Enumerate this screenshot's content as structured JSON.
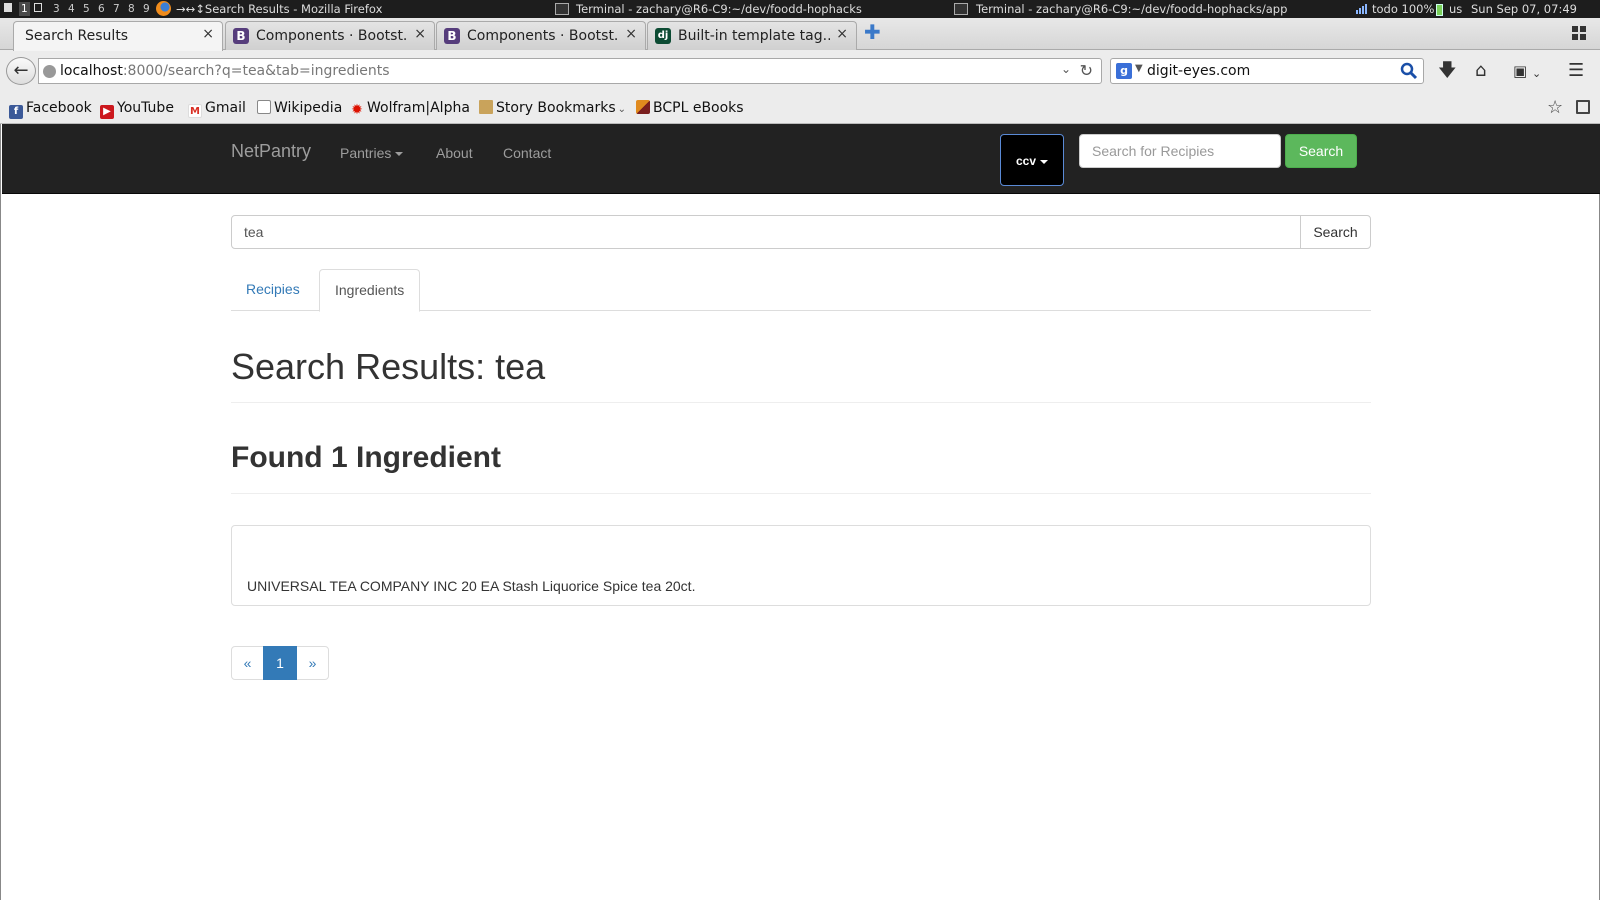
{
  "wm": {
    "workspaces": [
      "1",
      "2",
      "3",
      "4",
      "5",
      "6",
      "7",
      "8",
      "9"
    ],
    "window_title": "→↔↕Search Results - Mozilla Firefox",
    "terminal1": "Terminal - zachary@R6-C9:~/dev/foodd-hophacks",
    "terminal2": "Terminal - zachary@R6-C9:~/dev/foodd-hophacks/app",
    "status": "todo 100%",
    "keyboard": "us",
    "clock": "Sun Sep 07, 07:49"
  },
  "browser": {
    "tabs": [
      {
        "label": "Search Results",
        "active": true
      },
      {
        "label": "Components · Bootst...",
        "favicon": "B"
      },
      {
        "label": "Components · Bootst...",
        "favicon": "B"
      },
      {
        "label": "Built-in template tag...",
        "favicon": "dj"
      }
    ],
    "close_glyph": "×",
    "new_tab_glyph": "✚",
    "url_host": "localhost",
    "url_rest": ":8000/search?q=tea&tab=ingredients",
    "search_query": "digit-eyes.com",
    "search_engine_glyph": "g"
  },
  "bookmarks": [
    {
      "label": "Facebook",
      "icon": "facebook-icon",
      "glyph": "f",
      "color": "#3b5998"
    },
    {
      "label": "YouTube",
      "icon": "youtube-icon",
      "glyph": "▶",
      "color": "#cc181e"
    },
    {
      "label": "Gmail",
      "icon": "gmail-icon",
      "glyph": "M",
      "color": "#d93025"
    },
    {
      "label": "Wikipedia",
      "icon": "page-icon",
      "glyph": "",
      "color": "#ffffff"
    },
    {
      "label": "Wolfram|Alpha",
      "icon": "wolfram-icon",
      "glyph": "✹",
      "color": "#dd1100"
    },
    {
      "label": "Story Bookmarks",
      "icon": "folder-icon",
      "glyph": "",
      "color": "#c9a35b"
    },
    {
      "label": "BCPL eBooks",
      "icon": "bcpl-icon",
      "glyph": "",
      "color": "#e08a1e"
    }
  ],
  "site": {
    "brand": "NetPantry",
    "nav": {
      "pantries": "Pantries",
      "about": "About",
      "contact": "Contact"
    },
    "ccv_label": "ccv",
    "nav_search_placeholder": "Search for Recipies",
    "nav_search_button": "Search"
  },
  "main": {
    "search_value": "tea",
    "search_button": "Search",
    "tabs": [
      {
        "label": "Recipies",
        "active": false
      },
      {
        "label": "Ingredients",
        "active": true
      }
    ],
    "results_title": "Search Results: tea",
    "found_title": "Found 1 Ingredient",
    "results": [
      "UNIVERSAL TEA COMPANY INC 20 EA Stash Liquorice Spice tea 20ct."
    ],
    "pagination": {
      "prev": "«",
      "current": "1",
      "next": "»"
    }
  },
  "colors": {
    "navbar_bg": "#222222",
    "link": "#337ab7",
    "success": "#5cb85c"
  }
}
